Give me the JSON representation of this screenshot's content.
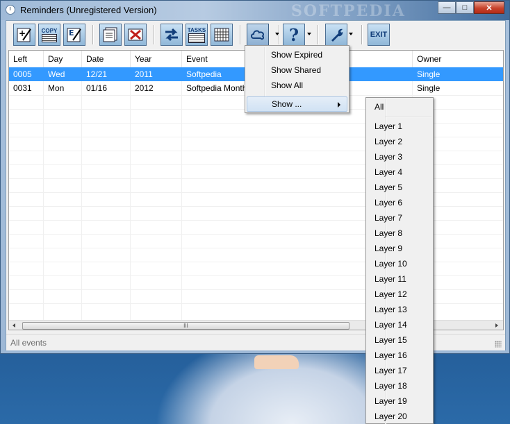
{
  "window": {
    "title": "Reminders (Unregistered Version)",
    "watermark": "SOFTPEDIA",
    "minimize_label": "—",
    "maximize_label": "□",
    "close_label": "✕"
  },
  "toolbar": {
    "copy_label": "COPY",
    "edit_label": "E",
    "tasks_label": "TASKS",
    "exit_label": "EXIT",
    "help_label": "?"
  },
  "table": {
    "columns": [
      "Left",
      "Day",
      "Date",
      "Year",
      "Event",
      "Owner"
    ],
    "rows": [
      {
        "left": "0005",
        "day": "Wed",
        "date": "12/21",
        "year": "2011",
        "event": "Softpedia",
        "owner": "Single",
        "selected": true
      },
      {
        "left": "0031",
        "day": "Mon",
        "date": "01/16",
        "year": "2012",
        "event": "Softpedia Month",
        "owner": "Single",
        "selected": false
      }
    ],
    "scroll_grip": "III"
  },
  "status": {
    "text": "All events"
  },
  "view_menu": {
    "items": [
      "Show Expired",
      "Show Shared",
      "Show All",
      "Show ..."
    ]
  },
  "show_submenu": {
    "first": "All",
    "layers": [
      "Layer 1",
      "Layer 2",
      "Layer 3",
      "Layer 4",
      "Layer 5",
      "Layer 6",
      "Layer 7",
      "Layer 8",
      "Layer 9",
      "Layer 10",
      "Layer 11",
      "Layer 12",
      "Layer 13",
      "Layer 14",
      "Layer 15",
      "Layer 16",
      "Layer 17",
      "Layer 18",
      "Layer 19",
      "Layer 20"
    ]
  },
  "colors": {
    "selection": "#3399ff",
    "toolbar_button": "#a9cbe6",
    "menu_bg": "#f0f0f0"
  }
}
